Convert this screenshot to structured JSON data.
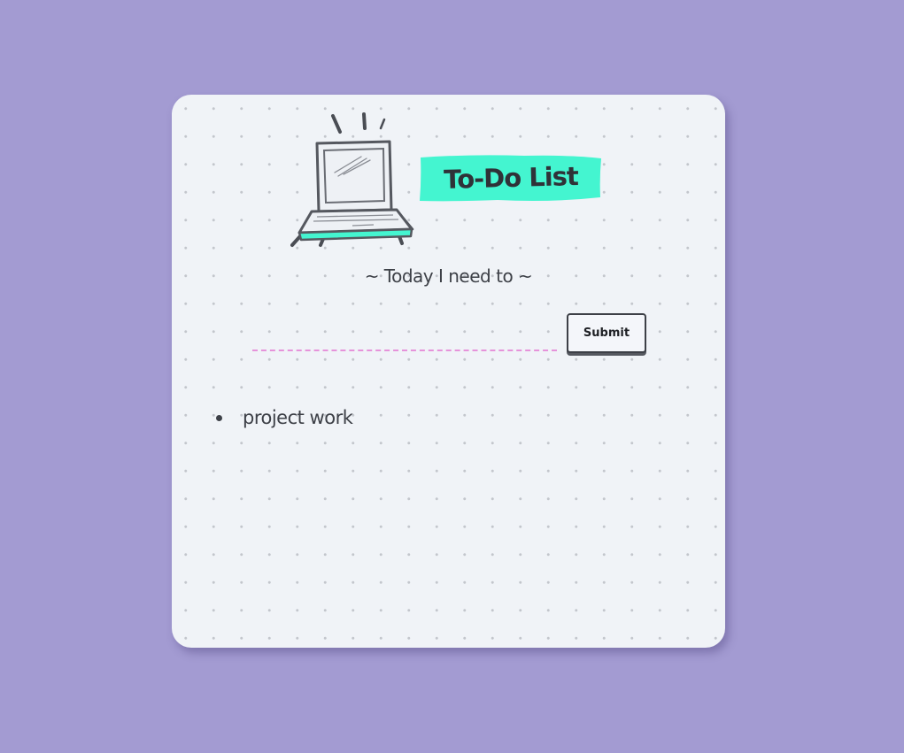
{
  "app": {
    "title": "To-Do List",
    "subtitle": "~ Today I need to ~"
  },
  "form": {
    "input_value": "",
    "input_placeholder": "",
    "submit_label": "Submit"
  },
  "todos": [
    {
      "text": "project work"
    }
  ],
  "colors": {
    "page_background": "#a39bd2",
    "card_background": "#f0f3f7",
    "title_highlight": "#44f5d0",
    "input_underline": "#e693da",
    "text": "#3d4047"
  },
  "icons": {
    "hero": "laptop-icon"
  }
}
